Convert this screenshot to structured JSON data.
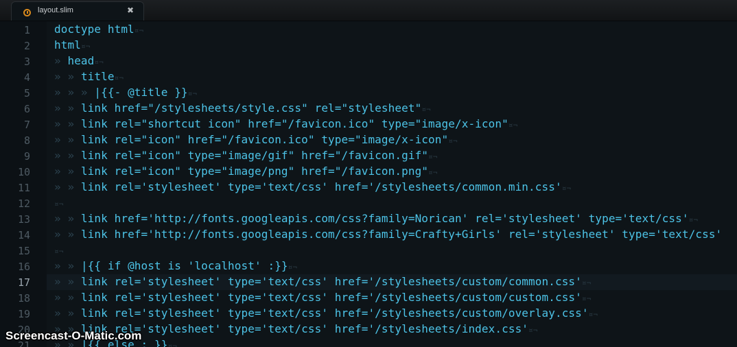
{
  "tab": {
    "label": "layout.slim",
    "file_icon": "slim-file-icon",
    "close_glyph": "✖"
  },
  "editor": {
    "current_line": 17,
    "eol_marker": "¤¬",
    "indent_marker": "»",
    "lines": [
      {
        "n": "1",
        "indent": 0,
        "text": "doctype html",
        "eol": true
      },
      {
        "n": "2",
        "indent": 0,
        "text": "html",
        "eol": true
      },
      {
        "n": "3",
        "indent": 1,
        "text": "head",
        "eol": true
      },
      {
        "n": "4",
        "indent": 2,
        "text": "title",
        "eol": true
      },
      {
        "n": "5",
        "indent": 3,
        "text": "|{{- @title }}",
        "eol": true
      },
      {
        "n": "6",
        "indent": 2,
        "text": "link href=\"/stylesheets/style.css\" rel=\"stylesheet\"",
        "eol": true
      },
      {
        "n": "7",
        "indent": 2,
        "text": "link rel=\"shortcut icon\" href=\"/favicon.ico\" type=\"image/x-icon\"",
        "eol": true
      },
      {
        "n": "8",
        "indent": 2,
        "text": "link rel=\"icon\" href=\"/favicon.ico\" type=\"image/x-icon\"",
        "eol": true
      },
      {
        "n": "9",
        "indent": 2,
        "text": "link rel=\"icon\" type=\"image/gif\" href=\"/favicon.gif\"",
        "eol": true
      },
      {
        "n": "10",
        "indent": 2,
        "text": "link rel=\"icon\" type=\"image/png\" href=\"/favicon.png\"",
        "eol": true
      },
      {
        "n": "11",
        "indent": 2,
        "text": "link rel='stylesheet' type='text/css' href='/stylesheets/common.min.css'",
        "eol": true
      },
      {
        "n": "12",
        "indent": 0,
        "text": "",
        "eol": true
      },
      {
        "n": "13",
        "indent": 2,
        "text": "link href='http://fonts.googleapis.com/css?family=Norican' rel='stylesheet' type='text/css'",
        "eol": true
      },
      {
        "n": "14",
        "indent": 2,
        "text": "link href='http://fonts.googleapis.com/css?family=Crafty+Girls' rel='stylesheet' type='text/css'",
        "eol": false
      },
      {
        "n": "15",
        "indent": 0,
        "text": "",
        "eol": true
      },
      {
        "n": "16",
        "indent": 2,
        "text": "|{{ if @host is 'localhost' :}}",
        "eol": true
      },
      {
        "n": "17",
        "indent": 2,
        "text": "link rel='stylesheet' type='text/css' href='/stylesheets/custom/common.css'",
        "eol": true
      },
      {
        "n": "18",
        "indent": 2,
        "text": "link rel='stylesheet' type='text/css' href='/stylesheets/custom/custom.css'",
        "eol": true
      },
      {
        "n": "19",
        "indent": 2,
        "text": "link rel='stylesheet' type='text/css' href='/stylesheets/custom/overlay.css'",
        "eol": true
      },
      {
        "n": "20",
        "indent": 2,
        "text": "link rel='stylesheet' type='text/css' href='/stylesheets/index.css'",
        "eol": true
      },
      {
        "n": "21",
        "indent": 2,
        "text": "|{{ else : }}",
        "eol": true
      }
    ]
  },
  "watermark": "Screencast-O-Matic.com",
  "colors": {
    "background": "#0e1418",
    "code_text": "#4dc4e8",
    "line_number": "#4e5a63",
    "tab_icon": "#d98a1c"
  }
}
